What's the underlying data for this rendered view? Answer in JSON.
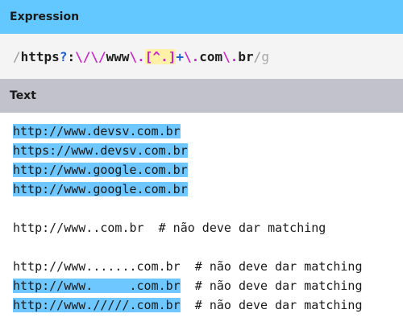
{
  "expression_section": {
    "title": "Expression",
    "tokens": [
      {
        "text": "/",
        "kind": "slash"
      },
      {
        "text": "https",
        "kind": "literal"
      },
      {
        "text": "?",
        "kind": "quant"
      },
      {
        "text": ":",
        "kind": "literal"
      },
      {
        "text": "\\/",
        "kind": "escape"
      },
      {
        "text": "\\/",
        "kind": "escape"
      },
      {
        "text": "www",
        "kind": "literal"
      },
      {
        "text": "\\.",
        "kind": "escape"
      },
      {
        "text": "[^.]",
        "kind": "class"
      },
      {
        "text": "+",
        "kind": "quant"
      },
      {
        "text": "\\.",
        "kind": "escape"
      },
      {
        "text": "com",
        "kind": "literal"
      },
      {
        "text": "\\.",
        "kind": "escape"
      },
      {
        "text": "br",
        "kind": "literal"
      },
      {
        "text": "/",
        "kind": "slash"
      },
      {
        "text": "g",
        "kind": "flag"
      }
    ]
  },
  "text_section": {
    "title": "Text",
    "lines": [
      {
        "match": "http://www.devsv.com.br",
        "rest": ""
      },
      {
        "match": "https://www.devsv.com.br",
        "rest": ""
      },
      {
        "match": "http://www.google.com.br",
        "rest": ""
      },
      {
        "match": "http://www.google.com.br",
        "rest": ""
      },
      {
        "match": "",
        "rest": ""
      },
      {
        "match": "",
        "rest": "http://www..com.br  # não deve dar matching"
      },
      {
        "match": "",
        "rest": ""
      },
      {
        "match": "",
        "rest": "http://www.......com.br  # não deve dar matching"
      },
      {
        "match": "http://www.     .com.br",
        "rest": "  # não deve dar matching"
      },
      {
        "match": "http://www./////.com.br",
        "rest": "  # não deve dar matching"
      }
    ]
  },
  "colors": {
    "expression_header": "#63c8ff",
    "text_header": "#c2c2cc",
    "match_highlight": "#6ec7ff",
    "escape": "#cc22cc",
    "quantifier": "#1a5fd4",
    "char_class_background": "#fff2a8"
  }
}
